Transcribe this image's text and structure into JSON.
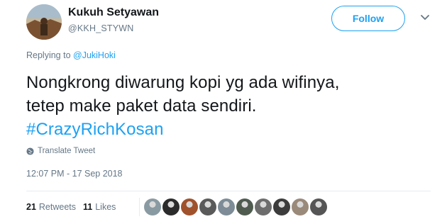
{
  "user": {
    "display_name": "Kukuh Setyawan",
    "handle": "@KKH_STYWN"
  },
  "follow_button": {
    "label": "Follow"
  },
  "reply": {
    "prefix": "Replying to ",
    "mention": "@JukiHoki"
  },
  "tweet": {
    "line1": "Nongkrong diwarung kopi yg ada wifinya,",
    "line2": "tetep make paket data sendiri.",
    "hashtag": "#CrazyRichKosan"
  },
  "translate": {
    "label": "Translate Tweet",
    "icon": "globe-icon"
  },
  "timestamp": "12:07 PM - 17 Sep 2018",
  "stats": {
    "retweets_count": "21",
    "retweets_label": "Retweets",
    "likes_count": "11",
    "likes_label": "Likes"
  },
  "likers": [
    {
      "name": "liker-avatar-1",
      "color": "#8a9aa2"
    },
    {
      "name": "liker-avatar-2",
      "color": "#2b2b2b"
    },
    {
      "name": "liker-avatar-3",
      "color": "#a0522d"
    },
    {
      "name": "liker-avatar-4",
      "color": "#5a5a5a"
    },
    {
      "name": "liker-avatar-5",
      "color": "#7d8c96"
    },
    {
      "name": "liker-avatar-6",
      "color": "#4f5b4f"
    },
    {
      "name": "liker-avatar-7",
      "color": "#6d6d6d"
    },
    {
      "name": "liker-avatar-8",
      "color": "#3c3c3c"
    },
    {
      "name": "liker-avatar-9",
      "color": "#9a8a7a"
    },
    {
      "name": "liker-avatar-10",
      "color": "#555555"
    }
  ],
  "colors": {
    "link_blue": "#1da1f2",
    "secondary_text": "#657786",
    "primary_text": "#14171a"
  }
}
